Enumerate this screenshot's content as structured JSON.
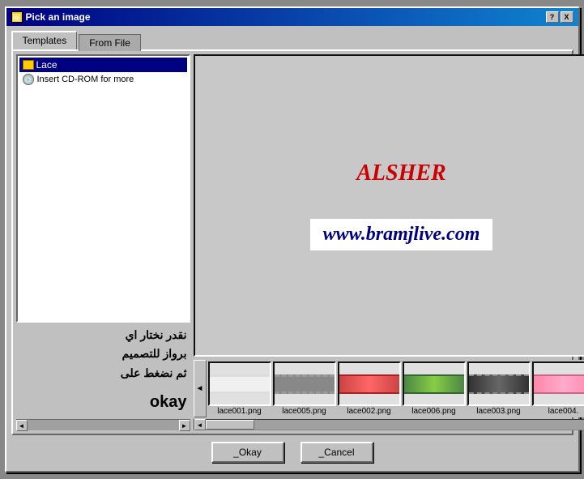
{
  "window": {
    "title": "Pick an image",
    "icon": "🖼",
    "help_btn": "?",
    "close_btn": "X"
  },
  "tabs": [
    {
      "id": "templates",
      "label": "Templates",
      "active": true
    },
    {
      "id": "from_file",
      "label": "From File",
      "active": false
    }
  ],
  "tree": {
    "items": [
      {
        "id": "lace",
        "label": "Lace",
        "type": "folder",
        "selected": true
      },
      {
        "id": "cd_rom",
        "label": "Insert CD-ROM for more",
        "type": "cd",
        "selected": false
      }
    ]
  },
  "arabic_lines": [
    "نقدر نختار اي",
    "برواز للتصميم",
    "ثم نضغط على"
  ],
  "okay_text": "okay",
  "preview": {
    "brand_text": "ALSHER",
    "website_text": "www.bramjlive.com"
  },
  "thumbnails": [
    {
      "id": "lace001",
      "label": "lace001.png",
      "style": "white"
    },
    {
      "id": "lace005",
      "label": "lace005.png",
      "style": "gray"
    },
    {
      "id": "lace002",
      "label": "lace002.png",
      "style": "red"
    },
    {
      "id": "lace006",
      "label": "lace006.png",
      "style": "green"
    },
    {
      "id": "lace003",
      "label": "lace003.png",
      "style": "dark"
    },
    {
      "id": "lace004",
      "label": "lace004.",
      "style": "pink"
    }
  ],
  "buttons": {
    "okay": {
      "label": "_Okay"
    },
    "cancel": {
      "label": "_Cancel"
    }
  }
}
